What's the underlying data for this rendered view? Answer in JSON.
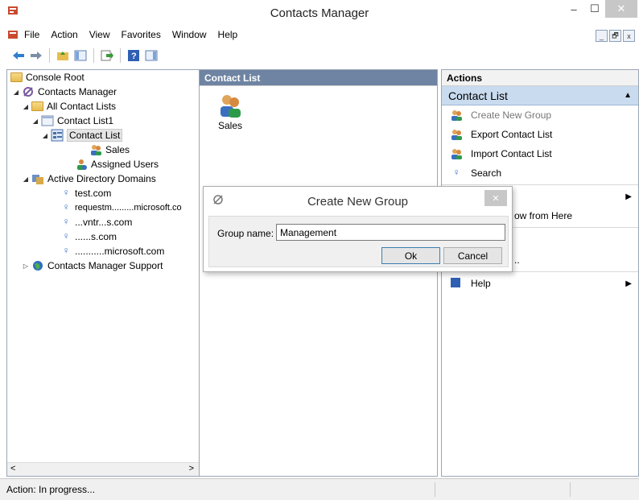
{
  "window": {
    "title": "Contacts Manager",
    "minimize": "–",
    "maximize": "☐",
    "close": "✕"
  },
  "menu": {
    "items": [
      "File",
      "Action",
      "View",
      "Favorites",
      "Window",
      "Help"
    ]
  },
  "mdi": {
    "minimize": "_",
    "restore": "🗗",
    "close": "x"
  },
  "left_pane": {
    "tree": [
      {
        "label": "Console Root",
        "icon": "folder-icon"
      },
      {
        "label": "Contacts Manager",
        "icon": "contacts-manager-icon"
      },
      {
        "label": "All Contact Lists",
        "icon": "folder-icon"
      },
      {
        "label": "Contact List1",
        "icon": "list-icon"
      },
      {
        "label": "Contact List",
        "icon": "contact-list-icon"
      },
      {
        "label": "Sales",
        "icon": "group-icon"
      },
      {
        "label": "Assigned Users",
        "icon": "users-icon"
      },
      {
        "label": "Active Directory Domains",
        "icon": "domains-icon"
      },
      {
        "label": "test.com",
        "icon": "key-icon"
      },
      {
        "label": "requestm.........microsoft.co",
        "icon": "key-icon"
      },
      {
        "label": "...vntr...s.com",
        "icon": "key-icon"
      },
      {
        "label": "......s.com",
        "icon": "key-icon"
      },
      {
        "label": "...........microsoft.com",
        "icon": "key-icon"
      },
      {
        "label": "Contacts Manager Support",
        "icon": "globe-icon"
      }
    ]
  },
  "mid_pane": {
    "header": "Contact List",
    "items": [
      {
        "label": "Sales",
        "icon": "group-icon"
      }
    ]
  },
  "right_pane": {
    "header": "Actions",
    "section": "Contact List",
    "items": [
      {
        "label": "Create New Group",
        "disabled": true
      },
      {
        "label": "Export Contact List"
      },
      {
        "label": "Import Contact List"
      },
      {
        "label": "Search"
      }
    ],
    "partial_item": "ow from Here",
    "help_item": "Help"
  },
  "status": {
    "text": "Action:  In progress..."
  },
  "dialog": {
    "title": "Create New Group",
    "close": "✕",
    "group_name_label": "Group name:",
    "group_name_value": "Management",
    "ok_label": "Ok",
    "cancel_label": "Cancel"
  },
  "colors": {
    "pane_header_active": "#6f84a3",
    "actions_section": "#c9dbef"
  }
}
